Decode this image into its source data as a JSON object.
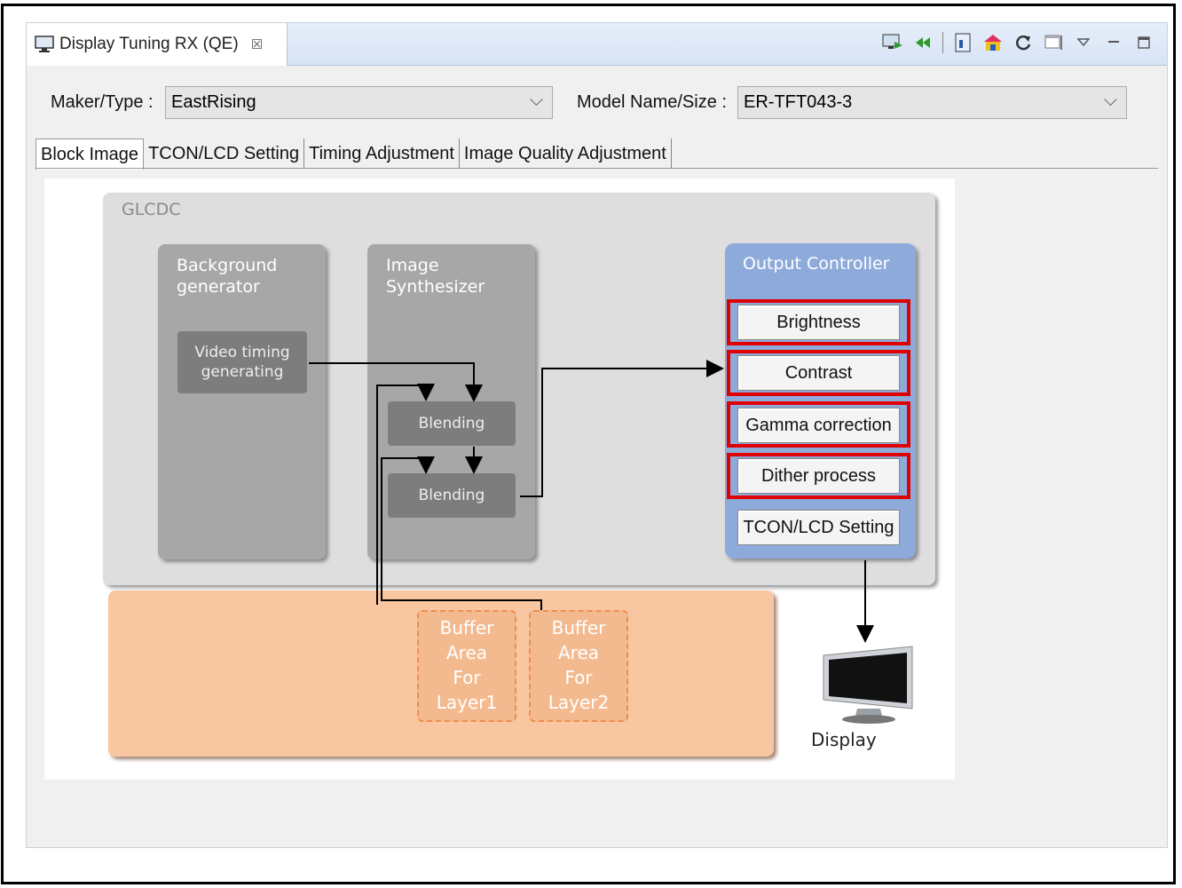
{
  "view": {
    "tab_title": "Display Tuning RX (QE)",
    "close_glyph": "☒",
    "toolbar_icons": [
      "monitor-run-icon",
      "rewind-icon",
      "export-icon",
      "palette-icon",
      "refresh-icon",
      "window-icon",
      "view-menu-icon",
      "minimize-icon",
      "maximize-icon"
    ]
  },
  "form": {
    "maker_label": "Maker/Type :",
    "maker_value": "EastRising",
    "model_label": "Model Name/Size :",
    "model_value": "ER-TFT043-3"
  },
  "tabs": [
    "Block Image",
    "TCON/LCD Setting",
    "Timing Adjustment",
    "Image Quality Adjustment"
  ],
  "diagram": {
    "glcdc_title": "GLCDC",
    "bg_gen_title": "Background\ngenerator",
    "video_timing": "Video timing\ngenerating",
    "synth_title": "Image\nSynthesizer",
    "blending1": "Blending",
    "blending2": "Blending",
    "output_title": "Output Controller",
    "output_buttons": [
      "Brightness",
      "Contrast",
      "Gamma correction",
      "Dither process",
      "TCON/LCD Setting"
    ],
    "buffer1": "Buffer\nArea\nFor\nLayer1",
    "buffer2": "Buffer\nArea\nFor\nLayer2",
    "display_label": "Display"
  },
  "colors": {
    "highlight": "#e00000",
    "output_controller": "#8eaadb",
    "external_memory": "#f8c7a1"
  }
}
